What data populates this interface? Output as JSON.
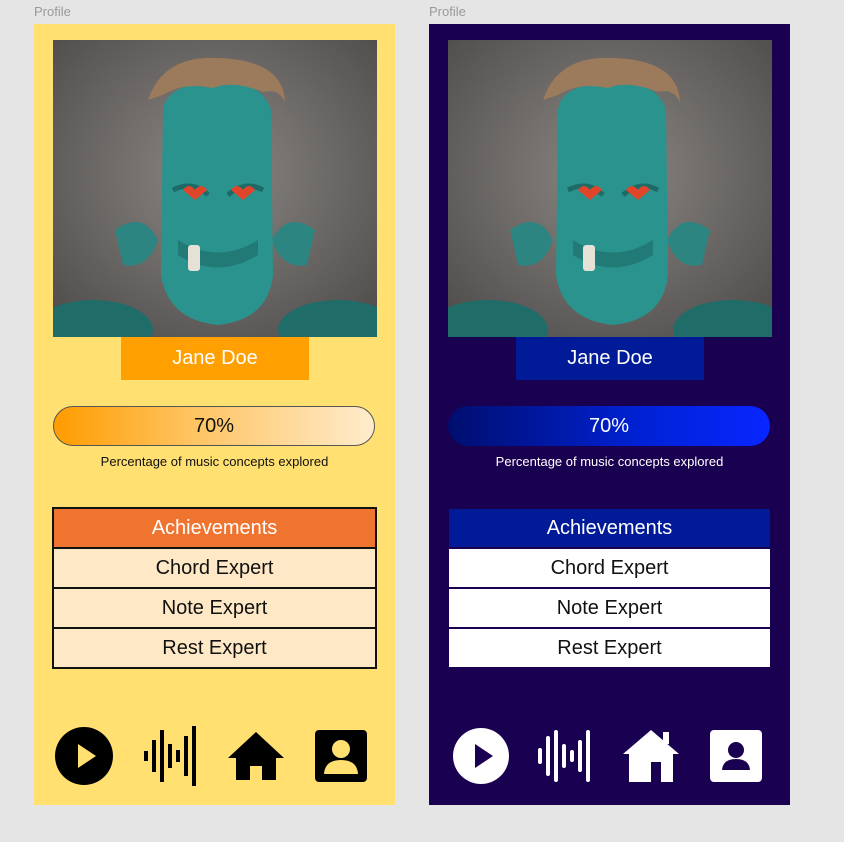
{
  "frames": [
    {
      "label": "Profile",
      "theme": "light",
      "background": "#ffe070",
      "user_name": "Jane Doe",
      "progress": {
        "value": 0.7,
        "label": "70%",
        "caption": "Percentage of music concepts explored"
      },
      "achievements": {
        "header": "Achievements",
        "items": [
          "Chord Expert",
          "Note Expert",
          "Rest Expert"
        ]
      },
      "nav": [
        {
          "icon": "play-circle-icon"
        },
        {
          "icon": "sound-wave-icon"
        },
        {
          "icon": "home-icon"
        },
        {
          "icon": "profile-icon"
        }
      ]
    },
    {
      "label": "Profile",
      "theme": "dark",
      "background": "#1a0050",
      "user_name": "Jane Doe",
      "progress": {
        "value": 0.7,
        "label": "70%",
        "caption": "Percentage of music concepts explored"
      },
      "achievements": {
        "header": "Achievements",
        "items": [
          "Chord Expert",
          "Note Expert",
          "Rest Expert"
        ]
      },
      "nav": [
        {
          "icon": "play-circle-icon"
        },
        {
          "icon": "sound-wave-icon"
        },
        {
          "icon": "home-icon"
        },
        {
          "icon": "profile-icon"
        }
      ]
    }
  ]
}
